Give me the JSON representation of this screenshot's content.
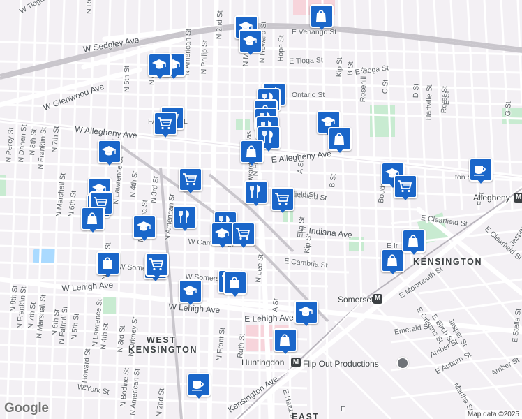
{
  "map": {
    "street_labels": [
      {
        "text": "W Tioga St",
        "kind": "v"
      },
      {
        "text": "N Randolph St",
        "kind": "v"
      },
      {
        "text": "W Sedgley Ave",
        "kind": "h"
      },
      {
        "text": "N 2nd St",
        "kind": "v"
      },
      {
        "text": "E Venango St",
        "kind": "h"
      },
      {
        "text": "N Philip St",
        "kind": "v"
      },
      {
        "text": "N American St",
        "kind": "v"
      },
      {
        "text": "N Mascher St",
        "kind": "v"
      },
      {
        "text": "N Howard St",
        "kind": "v"
      },
      {
        "text": "Hope St",
        "kind": "v"
      },
      {
        "text": "E Tioga St",
        "kind": "h"
      },
      {
        "text": "E Tioga St",
        "kind": "h"
      },
      {
        "text": "W Glenwood Ave",
        "kind": "h"
      },
      {
        "text": "N 5th St",
        "kind": "v"
      },
      {
        "text": "N 4th St",
        "kind": "v"
      },
      {
        "text": "Ontario St",
        "kind": "h"
      },
      {
        "text": "Kip St",
        "kind": "v"
      },
      {
        "text": "B St",
        "kind": "v"
      },
      {
        "text": "C St",
        "kind": "v"
      },
      {
        "text": "Rosehill St",
        "kind": "v"
      },
      {
        "text": "D St",
        "kind": "v"
      },
      {
        "text": "Rorer St",
        "kind": "v"
      },
      {
        "text": "Hartville St",
        "kind": "v"
      },
      {
        "text": "E St",
        "kind": "v"
      },
      {
        "text": "G St",
        "kind": "v"
      },
      {
        "text": "W Allegheny Ave",
        "kind": "h"
      },
      {
        "text": "E Allegheny Ave",
        "kind": "h"
      },
      {
        "text": "N Percy St",
        "kind": "v"
      },
      {
        "text": "N Darien St",
        "kind": "v"
      },
      {
        "text": "N 8th St",
        "kind": "v"
      },
      {
        "text": "N Franklin St",
        "kind": "v"
      },
      {
        "text": "N 7th St",
        "kind": "v"
      },
      {
        "text": "N Marshall St",
        "kind": "v"
      },
      {
        "text": "N 6th St",
        "kind": "v"
      },
      {
        "text": "N Lawrence St",
        "kind": "v"
      },
      {
        "text": "N 4th St",
        "kind": "v"
      },
      {
        "text": "N 3rd St",
        "kind": "v"
      },
      {
        "text": "N Orianna St",
        "kind": "v"
      },
      {
        "text": "N American St",
        "kind": "v"
      },
      {
        "text": "A St",
        "kind": "v"
      },
      {
        "text": "B St",
        "kind": "v"
      },
      {
        "text": "Boudinot St",
        "kind": "v"
      },
      {
        "text": "F St",
        "kind": "v"
      },
      {
        "text": "Clearfield St",
        "kind": "h"
      },
      {
        "text": "E Clearfield St",
        "kind": "h"
      },
      {
        "text": "E Indiana Ave",
        "kind": "h"
      },
      {
        "text": "Ella St",
        "kind": "v"
      },
      {
        "text": "Kip St",
        "kind": "v"
      },
      {
        "text": "W Cambria St",
        "kind": "h"
      },
      {
        "text": "W Somerset St",
        "kind": "h"
      },
      {
        "text": "E Cambria St",
        "kind": "h"
      },
      {
        "text": "N Reese St",
        "kind": "v"
      },
      {
        "text": "W Somerset St",
        "kind": "h"
      },
      {
        "text": "N Lee St",
        "kind": "v"
      },
      {
        "text": "W Lehigh Ave",
        "kind": "h"
      },
      {
        "text": "W Lehigh Ave",
        "kind": "h"
      },
      {
        "text": "E Lehigh Ave",
        "kind": "h"
      },
      {
        "text": "A St",
        "kind": "v"
      },
      {
        "text": "N 8th St",
        "kind": "v"
      },
      {
        "text": "N Franklin St",
        "kind": "v"
      },
      {
        "text": "N 7th St",
        "kind": "v"
      },
      {
        "text": "N Marshall St",
        "kind": "v"
      },
      {
        "text": "N 6th St",
        "kind": "v"
      },
      {
        "text": "N Fairhill St",
        "kind": "v"
      },
      {
        "text": "N 5th St",
        "kind": "v"
      },
      {
        "text": "N Lawrence St",
        "kind": "v"
      },
      {
        "text": "N 4th St",
        "kind": "v"
      },
      {
        "text": "N 3rd St",
        "kind": "v"
      },
      {
        "text": "N Orkney St",
        "kind": "v"
      },
      {
        "text": "N Howard St",
        "kind": "v"
      },
      {
        "text": "N Front St",
        "kind": "v"
      },
      {
        "text": "Ruth St",
        "kind": "h"
      },
      {
        "text": "E Monmouth St",
        "kind": "v"
      },
      {
        "text": "E Orleans St",
        "kind": "v"
      },
      {
        "text": "E Birch St",
        "kind": "v"
      },
      {
        "text": "Jasper St",
        "kind": "h"
      },
      {
        "text": "Emerald St",
        "kind": "h"
      },
      {
        "text": "Amber St",
        "kind": "h"
      },
      {
        "text": "E Auburn St",
        "kind": "v"
      },
      {
        "text": "Martha St",
        "kind": "h"
      },
      {
        "text": "Amber St",
        "kind": "v"
      },
      {
        "text": "E Stella St",
        "kind": "v"
      },
      {
        "text": "W York St",
        "kind": "h"
      },
      {
        "text": "N Bodine St",
        "kind": "v"
      },
      {
        "text": "N American St",
        "kind": "v"
      },
      {
        "text": "N 2nd St",
        "kind": "v"
      },
      {
        "text": "Kensington Ave",
        "kind": "h"
      },
      {
        "text": "E Hazzard St",
        "kind": "v"
      },
      {
        "text": "E Clearfield St",
        "kind": "h"
      },
      {
        "text": "Jasper St",
        "kind": "v"
      },
      {
        "text": "E Ir",
        "kind": "h"
      },
      {
        "text": "Ave",
        "kind": "h"
      },
      {
        "text": "ton St",
        "kind": "h"
      },
      {
        "text": "field St",
        "kind": "h"
      },
      {
        "text": "FA",
        "kind": "h"
      },
      {
        "text": "L",
        "kind": "h"
      },
      {
        "text": "N Mas",
        "kind": "v"
      },
      {
        "text": "N Howard St",
        "kind": "v"
      },
      {
        "text": "N Front St",
        "kind": "v"
      },
      {
        "text": "E",
        "kind": "h"
      }
    ],
    "area_labels": [
      "KENSINGTON",
      "WEST",
      "KENSINGTON",
      "EAST"
    ],
    "poi_labels": [
      "Allegheny",
      "Somerset",
      "Huntingdon",
      "Flip Out Productions"
    ],
    "pins": [
      {
        "type": "shopping-bag"
      },
      {
        "type": "school"
      },
      {
        "type": "school"
      },
      {
        "type": "school"
      },
      {
        "type": "school"
      },
      {
        "type": "restaurant"
      },
      {
        "type": "restaurant"
      },
      {
        "type": "shopping-bag"
      },
      {
        "type": "restaurant"
      },
      {
        "type": "grocery-cart"
      },
      {
        "type": "grocery-cart"
      },
      {
        "type": "school"
      },
      {
        "type": "restaurant"
      },
      {
        "type": "restaurant"
      },
      {
        "type": "shopping-bag"
      },
      {
        "type": "shopping-bag"
      },
      {
        "type": "school"
      },
      {
        "type": "grocery-cart"
      },
      {
        "type": "school"
      },
      {
        "type": "grocery-cart"
      },
      {
        "type": "coffee"
      },
      {
        "type": "shopping-bag"
      },
      {
        "type": "grocery-cart"
      },
      {
        "type": "shopping-bag"
      },
      {
        "type": "restaurant"
      },
      {
        "type": "grocery-cart"
      },
      {
        "type": "restaurant"
      },
      {
        "type": "school"
      },
      {
        "type": "restaurant"
      },
      {
        "type": "school"
      },
      {
        "type": "shopping-bag"
      },
      {
        "type": "shopping-bag"
      },
      {
        "type": "grocery-cart"
      },
      {
        "type": "grocery-cart"
      },
      {
        "type": "shopping-bag"
      },
      {
        "type": "grocery-cart"
      },
      {
        "type": "grocery-cart"
      },
      {
        "type": "school"
      },
      {
        "type": "shopping-bag"
      },
      {
        "type": "coffee"
      },
      {
        "type": "shopping-bag"
      },
      {
        "type": "school"
      },
      {
        "type": "school"
      }
    ],
    "google_logo": "Google",
    "attribution": "Map data ©2025",
    "colors": {
      "pin": "#1a66c9",
      "park": "#c8ebd1",
      "water": "#aadaff",
      "road": "#ffffff",
      "rail": "#c6c6c6",
      "highlight": "#f7d4db"
    }
  }
}
